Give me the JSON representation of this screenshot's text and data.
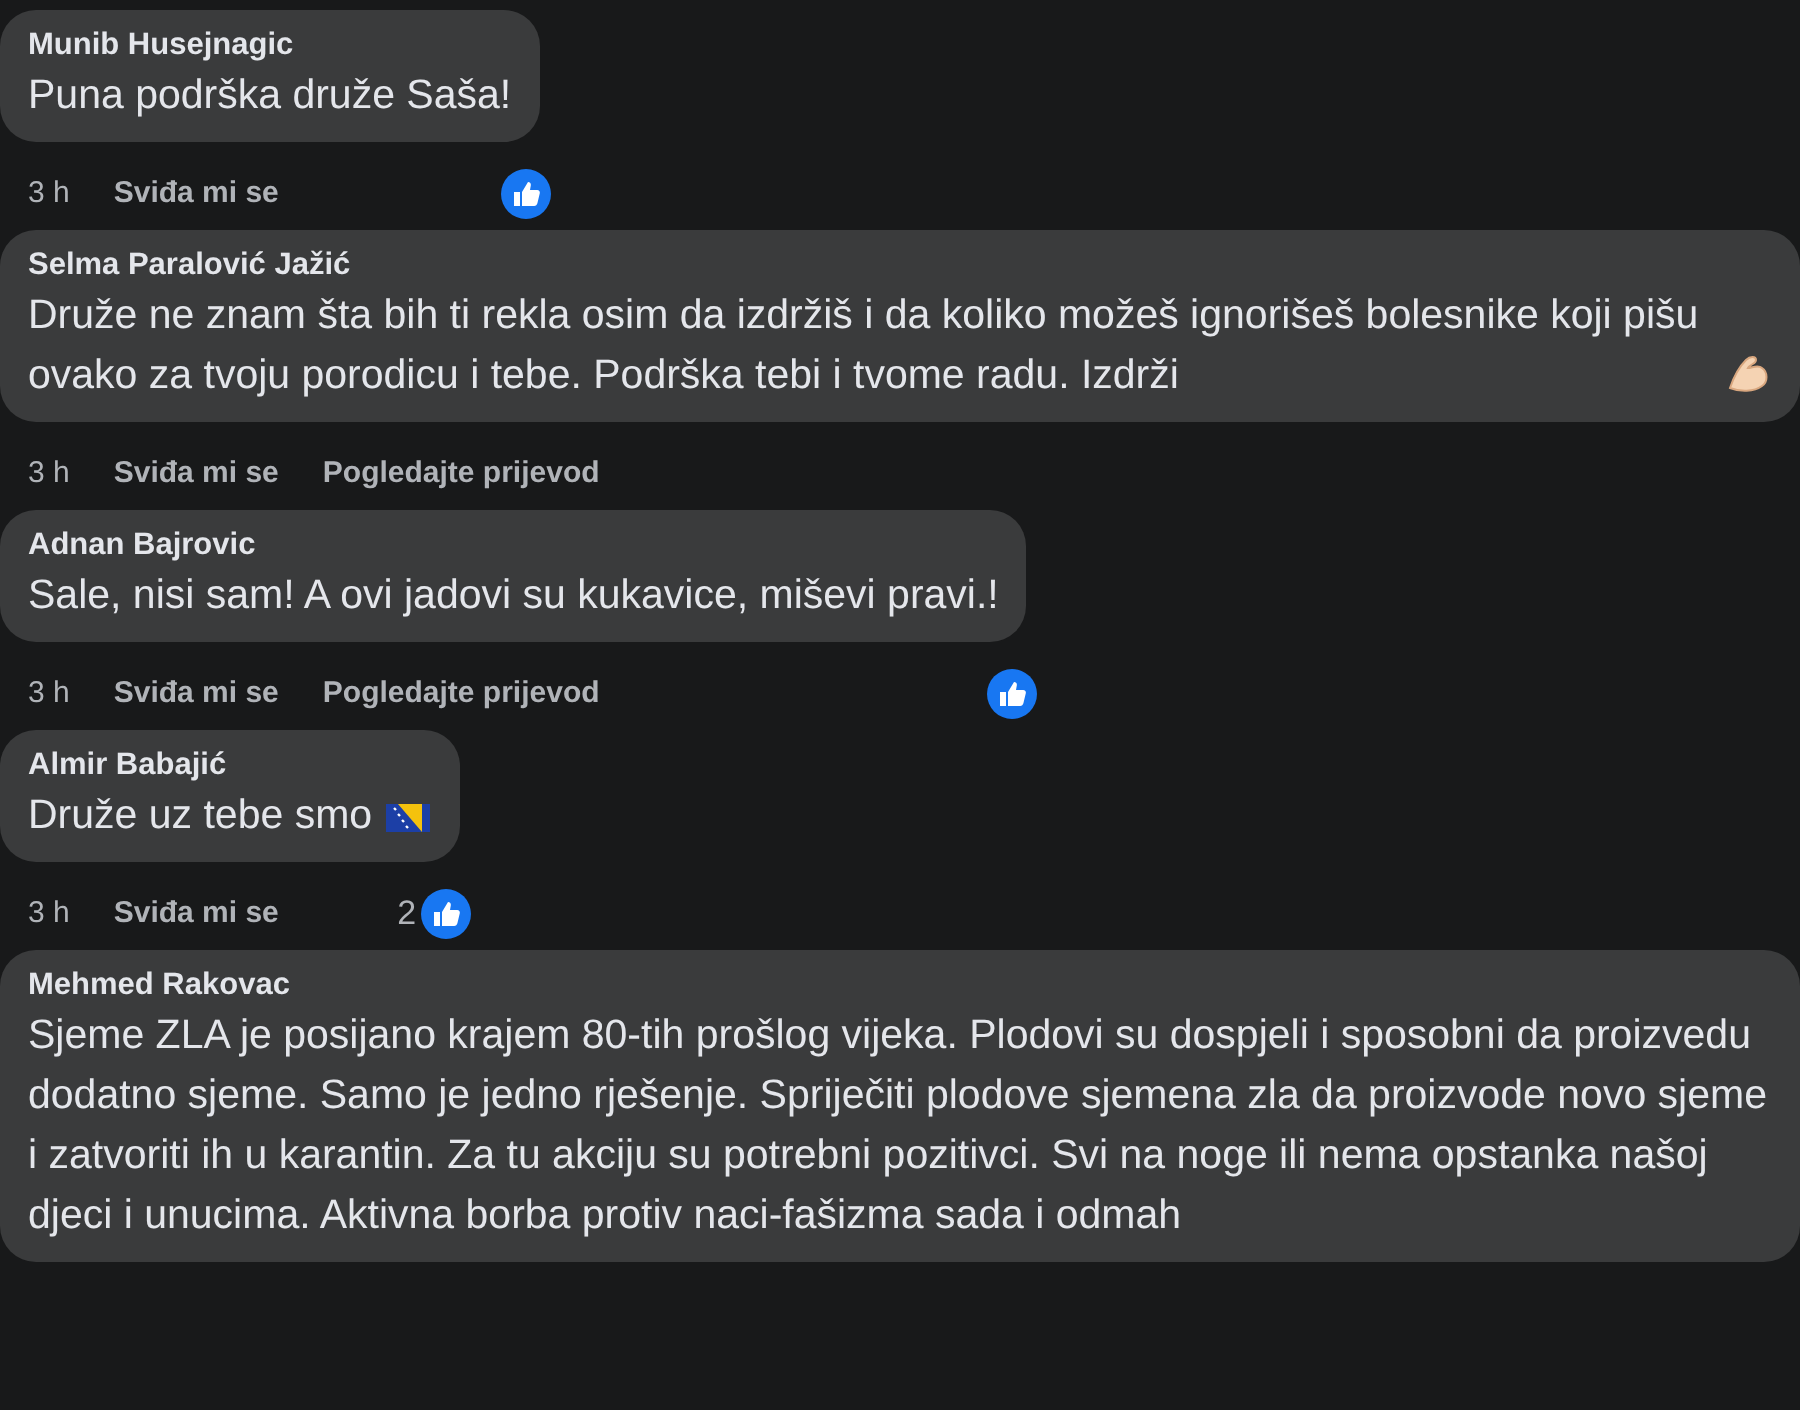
{
  "comments": [
    {
      "author": "Munib Husejnagic",
      "text": "Puna podrška druže Saša!",
      "time": "3 h",
      "like_label": "Sviđa mi se",
      "reaction": {
        "kind": "like"
      }
    },
    {
      "author": "Selma Paralović Jažić",
      "text": "Druže ne znam šta bih ti rekla osim da izdržiš i da koliko možeš ignorišeš bolesnike koji pišu ovako za tvoju porodicu i tebe. Podrška tebi i tvome radu. Izdrži",
      "emoji": {
        "kind": "flexed-arm"
      },
      "time": "3 h",
      "like_label": "Sviđa mi se",
      "translate_label": "Pogledajte prijevod"
    },
    {
      "author": "Adnan Bajrovic",
      "text": "Sale, nisi sam! A ovi jadovi su kukavice, miševi pravi.!",
      "time": "3 h",
      "like_label": "Sviđa mi se",
      "translate_label": "Pogledajte prijevod",
      "reaction": {
        "kind": "like"
      }
    },
    {
      "author": "Almir Babajić",
      "text": "Druže uz tebe smo",
      "emoji": {
        "kind": "flag"
      },
      "time": "3 h",
      "like_label": "Sviđa mi se",
      "reaction": {
        "kind": "like",
        "count": "2"
      }
    },
    {
      "author": "Mehmed Rakovac",
      "text": "Sjeme ZLA je posijano krajem 80-tih prošlog vijeka. Plodovi su dospjeli i sposobni da proizvedu dodatno sjeme. Samo je jedno rješenje. Spriječiti plodove sjemena zla da proizvode novo sjeme i zatvoriti ih u karantin. Za tu akciju su potrebni pozitivci. Svi na noge ili nema opstanka našoj djeci i unucima. Aktivna borba protiv naci-fašizma sada i odmah"
    }
  ]
}
